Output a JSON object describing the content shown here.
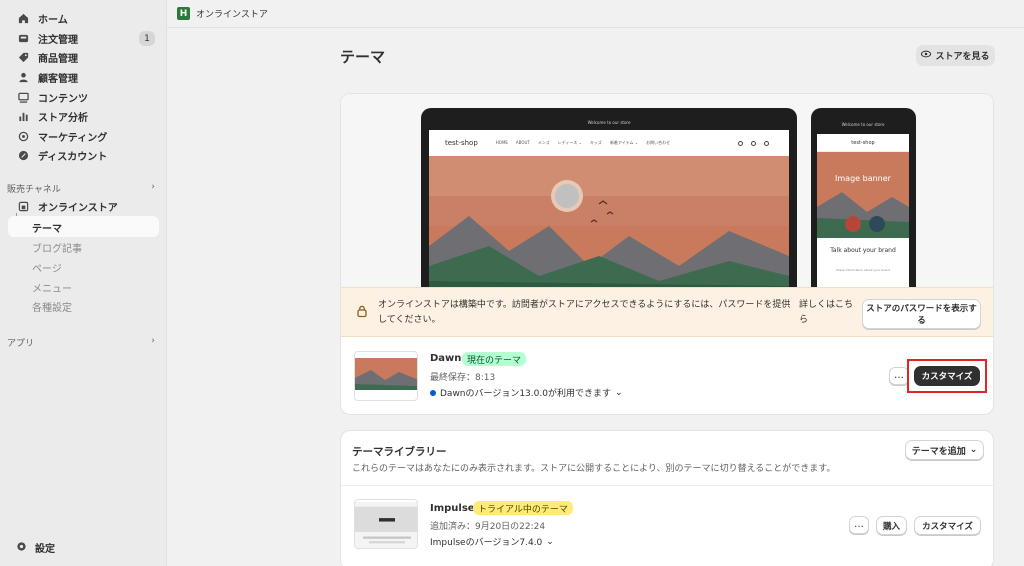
{
  "topbar": {
    "store_label": "オンラインストア",
    "logo_letter": "H"
  },
  "sidebar": {
    "items": [
      {
        "label": "ホーム",
        "icon": "home-icon"
      },
      {
        "label": "注文管理",
        "icon": "orders-icon",
        "badge": "1"
      },
      {
        "label": "商品管理",
        "icon": "tag-icon"
      },
      {
        "label": "顧客管理",
        "icon": "person-icon"
      },
      {
        "label": "コンテンツ",
        "icon": "content-icon"
      },
      {
        "label": "ストア分析",
        "icon": "chart-icon"
      },
      {
        "label": "マーケティング",
        "icon": "target-icon"
      },
      {
        "label": "ディスカウント",
        "icon": "discount-icon"
      }
    ],
    "sales_channels_label": "販売チャネル",
    "online_store_label": "オンラインストア",
    "sub_items": [
      {
        "label": "テーマ",
        "active": true
      },
      {
        "label": "ブログ記事"
      },
      {
        "label": "ページ"
      },
      {
        "label": "メニュー"
      },
      {
        "label": "各種設定"
      }
    ],
    "apps_label": "アプリ",
    "settings_label": "設定"
  },
  "main": {
    "title": "テーマ",
    "view_store_label": "ストアを見る",
    "preview": {
      "announcement": "Welcome to our store",
      "shop_name": "test-shop",
      "menu": [
        "HOME",
        "ABOUT",
        "メンズ",
        "レディース ⌄",
        "キッズ",
        "新着アイテム ⌄",
        "お問い合わせ"
      ],
      "phone_banner": "Image banner",
      "phone_talk": "Talk about your brand",
      "phone_small": "Share information about your brand"
    },
    "warning": {
      "message": "オンラインストアは構築中です。訪問者がストアにアクセスできるようにするには、パスワードを提供してください。",
      "more": "詳しくはこちら",
      "button": "ストアのパスワードを表示する"
    },
    "current_theme": {
      "name": "Dawn",
      "badge": "現在のテーマ",
      "saved": "最終保存：8:13",
      "version": "Dawnのバージョン13.0.0が利用できます",
      "more": "…",
      "customize": "カスタマイズ"
    },
    "library": {
      "title": "テーマライブラリー",
      "description": "これらのテーマはあなたにのみ表示されます。ストアに公開することにより、別のテーマに切り替えることができます。",
      "add_button": "テーマを追加",
      "theme": {
        "name": "Impulse",
        "badge": "トライアル中のテーマ",
        "added": "追加済み：9月20日の22:24",
        "version": "Impulseのバージョン7.4.0",
        "more": "…",
        "buy": "購入",
        "customize": "カスタマイズ"
      }
    }
  },
  "colors": {
    "accent_dark": "#303030",
    "highlight": "#e02424",
    "badge_green": "#b4fed2",
    "badge_yellow": "#ffeb78",
    "warning_bg": "#fdf1e3"
  }
}
